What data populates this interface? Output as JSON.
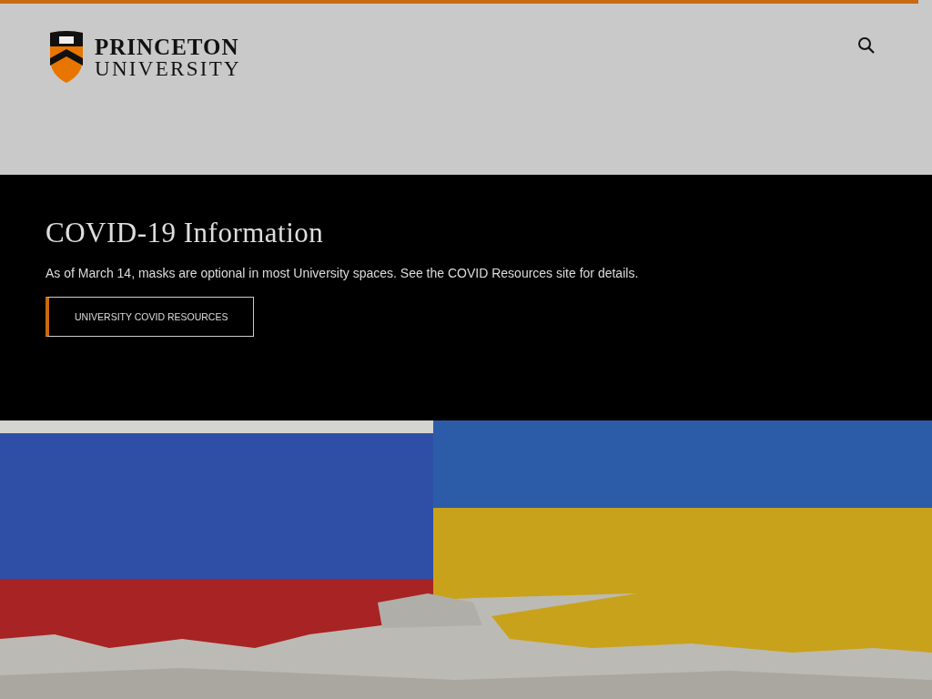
{
  "header": {
    "logo": {
      "line_1": "PRINCETON",
      "line_2": "UNIVERSITY"
    }
  },
  "notice": {
    "title": "COVID-19 Information",
    "text": "As of March 14, masks are optional in most University spaces. See the COVID Resources site for details.",
    "button": "UNIVERSITY COVID RESOURCES"
  }
}
